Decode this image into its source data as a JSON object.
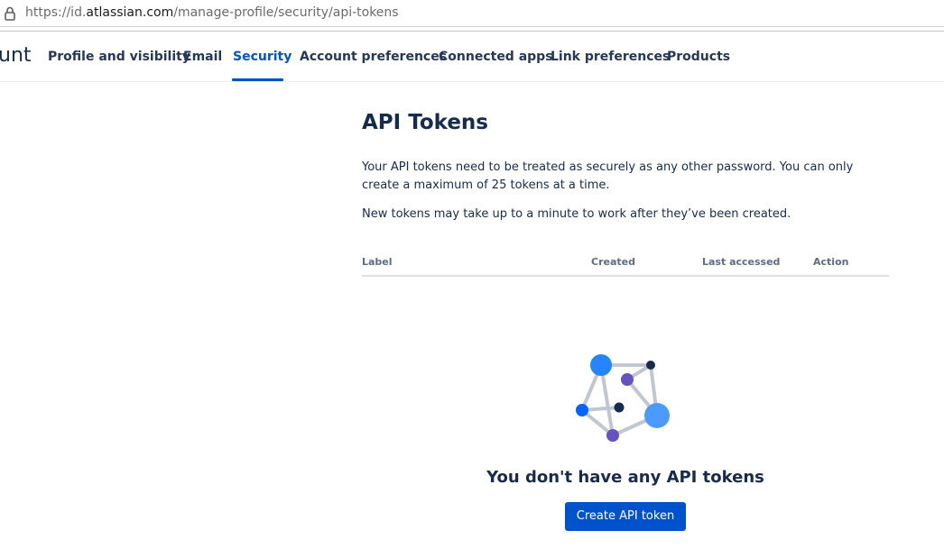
{
  "browser": {
    "url_prefix": "https://id.",
    "url_domain": "atlassian.com",
    "url_path": "/manage-profile/security/api-tokens"
  },
  "header": {
    "brand_fragment": "unt",
    "tabs": [
      {
        "label": "Profile and visibility",
        "active": false
      },
      {
        "label": "Email",
        "active": false
      },
      {
        "label": "Security",
        "active": true
      },
      {
        "label": "Account preferences",
        "active": false
      },
      {
        "label": "Connected apps",
        "active": false
      },
      {
        "label": "Link preferences",
        "active": false
      },
      {
        "label": "Products",
        "active": false
      }
    ]
  },
  "main": {
    "title": "API Tokens",
    "description": "Your API tokens need to be treated as securely as any other password. You can only create a maximum of 25 tokens at a time.",
    "note": "New tokens may take up to a minute to work after they’ve been created.",
    "table": {
      "columns": [
        "Label",
        "Created",
        "Last accessed",
        "Action"
      ],
      "rows": []
    },
    "empty_state": {
      "illustration": "network-nodes-illustration",
      "title": "You don't have any API tokens",
      "button_label": "Create API token"
    }
  },
  "colors": {
    "accent": "#0052cc",
    "text": "#172b4d",
    "muted_header": "#5e6c84"
  }
}
